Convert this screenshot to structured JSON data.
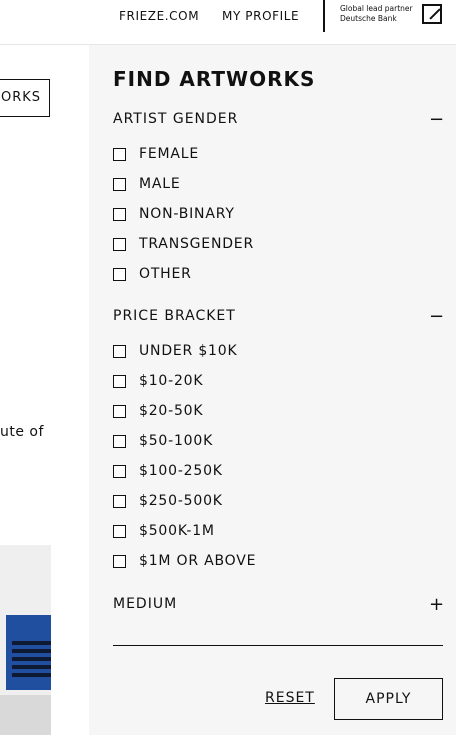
{
  "header": {
    "links": [
      "FRIEZE.COM",
      "MY PROFILE"
    ],
    "partner_line1": "Global lead partner",
    "partner_line2": "Deutsche Bank"
  },
  "background": {
    "button_label": "ORKS",
    "text_fragment": "ute of"
  },
  "filters": {
    "title": "FIND ARTWORKS",
    "sections": [
      {
        "label": "ARTIST GENDER",
        "toggle": "−",
        "options": [
          "FEMALE",
          "MALE",
          "NON-BINARY",
          "TRANSGENDER",
          "OTHER"
        ]
      },
      {
        "label": "PRICE BRACKET",
        "toggle": "−",
        "options": [
          "UNDER $10K",
          "$10-20K",
          "$20-50K",
          "$50-100K",
          "$100-250K",
          "$250-500K",
          "$500K-1M",
          "$1M OR ABOVE"
        ]
      },
      {
        "label": "MEDIUM",
        "toggle": "+",
        "options": []
      }
    ],
    "reset_label": "RESET",
    "apply_label": "APPLY"
  }
}
